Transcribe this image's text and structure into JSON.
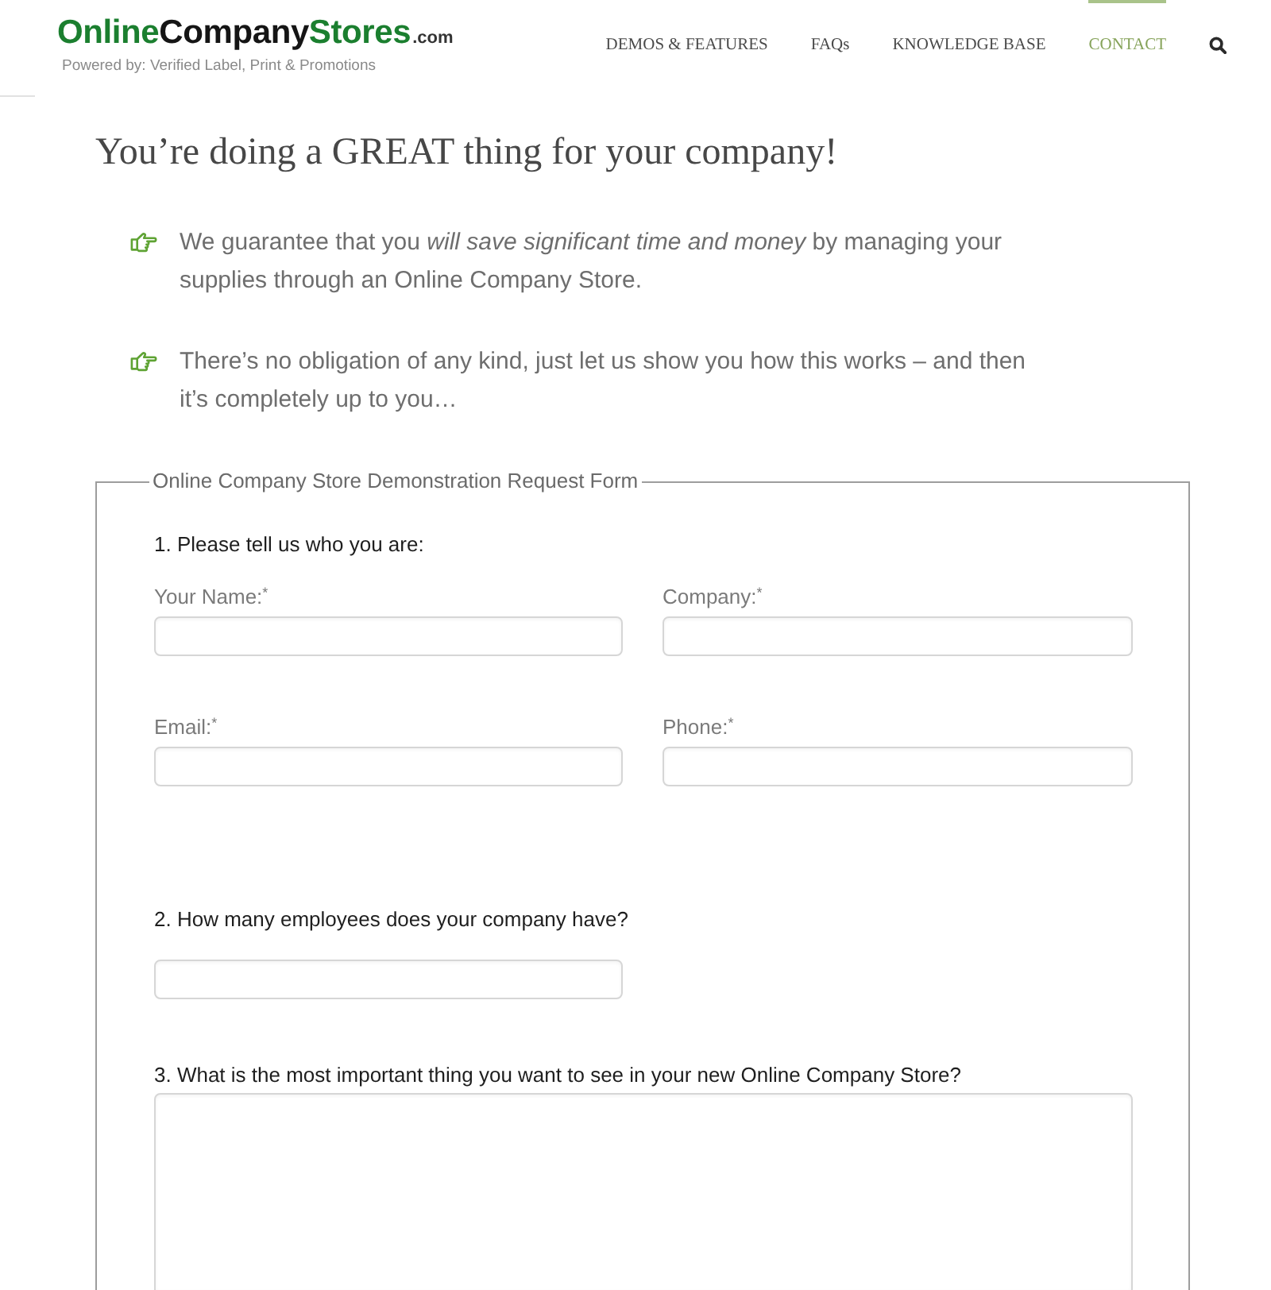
{
  "header": {
    "logo": {
      "parts": [
        {
          "text": "Online",
          "color": "#1b7f2f",
          "kind": "word"
        },
        {
          "text": "Company",
          "color": "#151515",
          "kind": "word"
        },
        {
          "text": "Stores",
          "color": "#1b7f2f",
          "kind": "word"
        },
        {
          "text": ".com",
          "color": "#333333",
          "kind": "suffix"
        }
      ]
    },
    "tagline": "Powered by: Verified Label, Print & Promotions",
    "nav": [
      {
        "label": "DEMOS & FEATURES",
        "selected": false
      },
      {
        "label": "FAQs",
        "selected": false
      },
      {
        "label": "KNOWLEDGE BASE",
        "selected": false
      },
      {
        "label": "CONTACT",
        "selected": true
      }
    ]
  },
  "page_title": "You’re doing a GREAT thing for your company!",
  "bullets": [
    "We guarantee that you *will save significant time and money* by managing your supplies through an Online Company Store.",
    "There’s no obligation of any kind, just let us show you how this works – and then it’s completely up to you…"
  ],
  "form": {
    "legend": "Online Company Store Demonstration Request Form",
    "sections": [
      {
        "heading": "1. Please tell us who you are:",
        "fields": [
          {
            "kind": "input",
            "label": "Your Name:$^{*}$"
          },
          {
            "kind": "input",
            "label": "Company:$^{*}$"
          },
          {
            "kind": "input",
            "label": "Email:$^{*}$"
          },
          {
            "kind": "input",
            "label": "Phone:$^{*}$"
          }
        ]
      },
      {
        "heading": "2. How many employees does your company have?",
        "fields": [
          {
            "kind": "input"
          }
        ]
      },
      {
        "heading": "3. What is the most important thing you want to see in your new Online Company Store?",
        "fields": [
          {
            "kind": "textarea"
          }
        ]
      }
    ]
  }
}
